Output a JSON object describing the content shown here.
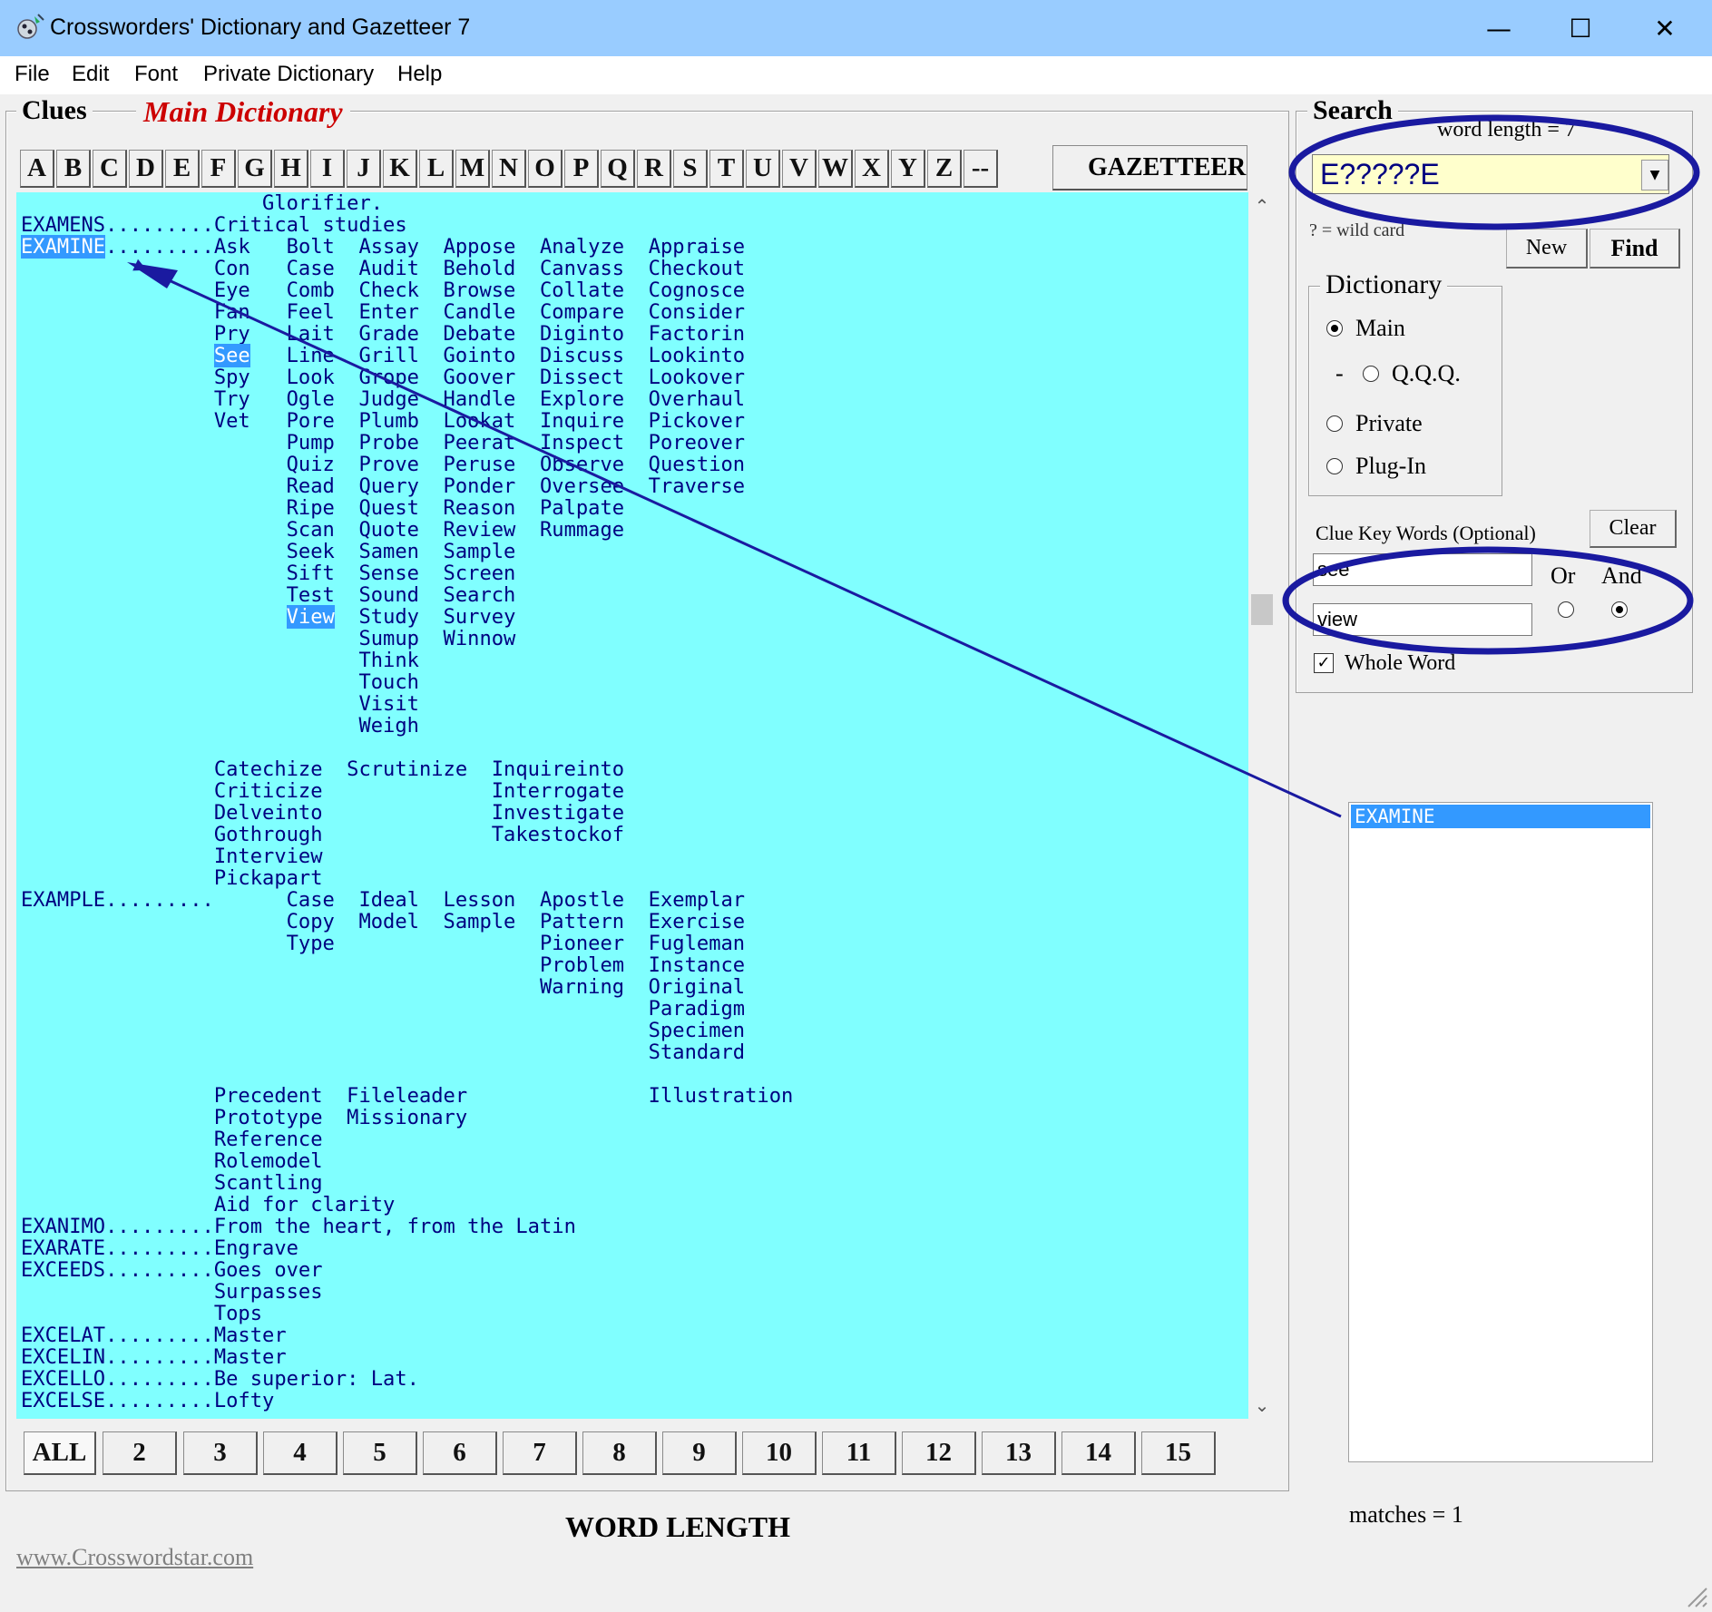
{
  "window": {
    "title": "Crosswordеrs' Dictionary and Gazetteer 7",
    "minimize": "—",
    "maximize": "☐",
    "close": "✕"
  },
  "menu": [
    "File",
    "Edit",
    "Font",
    "Private Dictionary",
    "Help"
  ],
  "clues_panel": {
    "legend": "Clues",
    "subtitle": "Main Dictionary",
    "letters": [
      "A",
      "B",
      "C",
      "D",
      "E",
      "F",
      "G",
      "H",
      "I",
      "J",
      "K",
      "L",
      "M",
      "N",
      "O",
      "P",
      "Q",
      "R",
      "S",
      "T",
      "U",
      "V",
      "W",
      "X",
      "Y",
      "Z",
      "--"
    ],
    "gazetteer_label": "GAZETTEER",
    "lines": [
      "                    Glorifier.",
      "EXAMENS.........Critical studies",
      "[[EXAMINE]].........Ask   Bolt  Assay  Appose  Analyze  Appraise",
      "                Con   Case  Audit  Behold  Canvass  Checkout",
      "                Eye   Comb  Check  Browse  Collate  Cognosce",
      "                Fan   Feel  Enter  Candle  Compare  Consider",
      "                Pry   Lait  Grade  Debate  Diginto  Factorin",
      "                [[See]]   Line  Grill  Gointo  Discuss  Lookinto",
      "                Spy   Look  Grope  Goover  Dissect  Lookover",
      "                Try   Ogle  Judge  Handle  Explore  Overhaul",
      "                Vet   Pore  Plumb  Lookat  Inquire  Pickover",
      "                      Pump  Probe  Peerat  Inspect  Poreover",
      "                      Quiz  Prove  Peruse  Observe  Question",
      "                      Read  Query  Ponder  Oversee  Traverse",
      "                      Ripe  Quest  Reason  Palpate",
      "                      Scan  Quote  Review  Rummage",
      "                      Seek  Samen  Sample",
      "                      Sift  Sense  Screen",
      "                      Test  Sound  Search",
      "                      [[View]]  Study  Survey",
      "                            Sumup  Winnow",
      "                            Think",
      "                            Touch",
      "                            Visit",
      "                            Weigh",
      "",
      "                Catechize  Scrutinize  Inquireinto",
      "                Criticize              Interrogate",
      "                Delveinto              Investigate",
      "                Gothrough              Takestockof",
      "                Interview",
      "                Pickapart",
      "EXAMPLE.........      Case  Ideal  Lesson  Apostle  Exemplar",
      "                      Copy  Model  Sample  Pattern  Exercise",
      "                      Type                 Pioneer  Fugleman",
      "                                           Problem  Instance",
      "                                           Warning  Original",
      "                                                    Paradigm",
      "                                                    Specimen",
      "                                                    Standard",
      "",
      "                Precedent  Fileleader               Illustration",
      "                Prototype  Missionary",
      "                Reference",
      "                Rolemodel",
      "                Scantling",
      "                Aid for clarity",
      "EXANIMO.........From the heart, from the Latin",
      "EXARATE.........Engrave",
      "EXCEEDS.........Goes over",
      "                Surpasses",
      "                Tops",
      "EXCELAT.........Master",
      "EXCELIN.........Master",
      "EXCELLO.........Be superior: Lat.",
      "EXCELSE.........Lofty"
    ],
    "length_buttons": [
      "ALL",
      "2",
      "3",
      "4",
      "5",
      "6",
      "7",
      "8",
      "9",
      "10",
      "11",
      "12",
      "13",
      "14",
      "15"
    ],
    "word_length_label": "WORD LENGTH",
    "site_link": "www.Crosswordstar.com"
  },
  "search_panel": {
    "legend": "Search",
    "word_length_text": "word length =",
    "word_length_value": "7",
    "pattern": "E?????E",
    "wildcard_hint": "? = wild card",
    "new_label": "New",
    "find_label": "Find",
    "dictionary": {
      "legend": "Dictionary",
      "options": [
        {
          "label": "Main",
          "selected": true
        },
        {
          "label": "Q.Q.Q.",
          "prefix": "-",
          "selected": false
        },
        {
          "label": "Private",
          "selected": false
        },
        {
          "label": "Plug-In",
          "selected": false
        }
      ]
    },
    "clue_keywords_label": "Clue Key Words (Optional)",
    "clear_label": "Clear",
    "keyword1": "see",
    "keyword2": "view",
    "or_label": "Or",
    "and_label": "And",
    "mode_selected": "And",
    "whole_word_label": "Whole Word",
    "whole_word_checked": true
  },
  "results": {
    "items": [
      "EXAMINE"
    ],
    "matches_label": "matches =",
    "matches_count": "1"
  },
  "colors": {
    "titlebar": "#99ccff",
    "textarea_bg": "#80ffff",
    "text": "#000080",
    "highlight": "#3399ff",
    "subtitle": "#cc0000",
    "annotation": "#1a1aa0"
  }
}
